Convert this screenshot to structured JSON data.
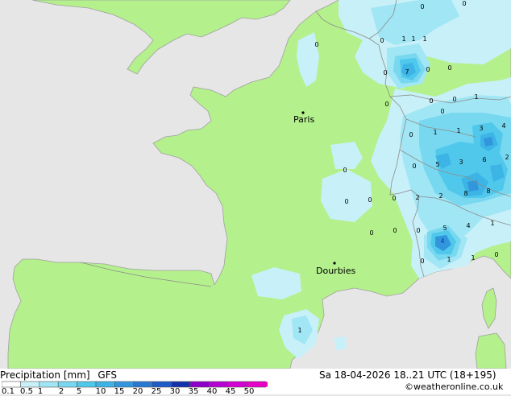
{
  "footer": {
    "title": "Precipitation [mm]",
    "model": "GFS",
    "datetime": "Sa 18-04-2026 18..21 UTC (18+195)",
    "copyright": "©weatheronline.co.uk"
  },
  "legend": {
    "ticks": [
      "0.1",
      "0.5",
      "1",
      "2",
      "5",
      "10",
      "15",
      "20",
      "25",
      "30",
      "35",
      "40",
      "45",
      "50"
    ],
    "colors": [
      "#ffffff",
      "#c8f0f8",
      "#a0e6f4",
      "#78d8f0",
      "#50c8ec",
      "#3cb4e6",
      "#3296dc",
      "#2878d2",
      "#1e5ac8",
      "#1432aa",
      "#8c00c8",
      "#b400d2",
      "#d200d2",
      "#e600c8",
      "#f000b4"
    ]
  },
  "cities": [
    {
      "name": "Paris"
    },
    {
      "name": "Dourbies"
    }
  ],
  "map_colors": {
    "land": "#b4f08c",
    "sea": "#e6e6e6",
    "border": "#8c8c8c",
    "coast": "#a0a0a0"
  },
  "values": [
    "0",
    "1",
    "1",
    "1",
    "0",
    "7",
    "0",
    "0",
    "0",
    "0",
    "1",
    "3",
    "4",
    "0",
    "1",
    "1",
    "3",
    "5",
    "0",
    "6",
    "2",
    "0",
    "2",
    "8",
    "8",
    "0",
    "0",
    "2",
    "0",
    "0",
    "5",
    "4",
    "1",
    "0",
    "4",
    "1",
    "1",
    "0",
    "1",
    "0",
    "0",
    "0",
    "0",
    "0",
    "0",
    "0"
  ]
}
